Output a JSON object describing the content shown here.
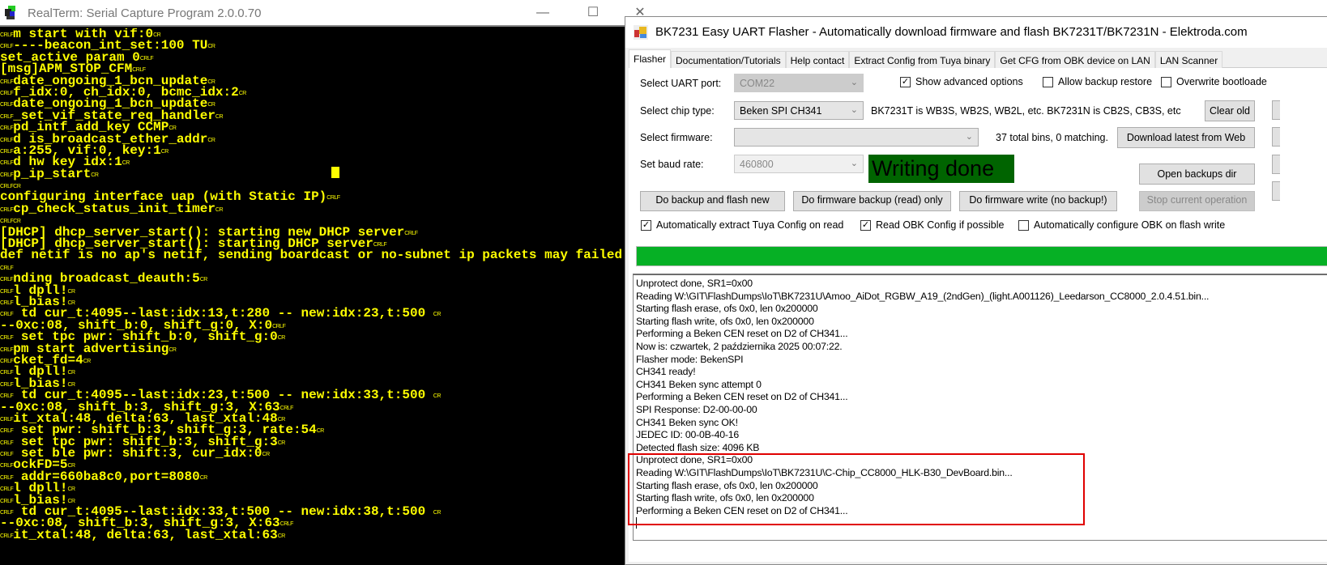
{
  "realterm": {
    "title": "RealTerm: Serial Capture Program 2.0.0.70",
    "minimize_glyph": "—",
    "maximize_glyph": "☐",
    "close_glyph": "✕",
    "lines": [
      {
        "pre": "CRLF",
        "text": "m start with vif:0",
        "post": "CR"
      },
      {
        "pre": "CRLF",
        "text": "----beacon_int_set:100 TU",
        "post": "CR"
      },
      {
        "pre": "",
        "text": "set_active param 0",
        "post": "CRLF"
      },
      {
        "pre": "",
        "text": "[msg]APM_STOP_CFM",
        "post": "CRLF"
      },
      {
        "pre": "CRLF",
        "text": "date_ongoing_1_bcn_update",
        "post": "CR"
      },
      {
        "pre": "CRLF",
        "text": "f_idx:0, ch_idx:0, bcmc_idx:2",
        "post": "CR"
      },
      {
        "pre": "CRLF",
        "text": "date_ongoing_1_bcn_update",
        "post": "CR"
      },
      {
        "pre": "CRLF",
        "text": "_set_vif_state_req_handler",
        "post": "CR"
      },
      {
        "pre": "CRLF",
        "text": "pd_intf_add_key CCMP",
        "post": "CR"
      },
      {
        "pre": "CRLF",
        "text": "d is_broadcast_ether_addr",
        "post": "CR"
      },
      {
        "pre": "CRLF",
        "text": "a:255, vif:0, key:1",
        "post": "CR"
      },
      {
        "pre": "CRLF",
        "text": "d hw key idx:1",
        "post": "CR"
      },
      {
        "pre": "CRLF",
        "text": "p_ip_start",
        "post": "CR"
      },
      {
        "pre": "CRLF",
        "text": "",
        "post": "CR"
      },
      {
        "pre": "",
        "text": "configuring interface uap (with Static IP)",
        "post": "CRLF"
      },
      {
        "pre": "CRLF",
        "text": "cp_check_status_init_timer",
        "post": "CR"
      },
      {
        "pre": "CRLF",
        "text": "",
        "post": "CR"
      },
      {
        "pre": "",
        "text": "[DHCP] dhcp_server_start(): starting new DHCP server",
        "post": "CRLF"
      },
      {
        "pre": "",
        "text": "[DHCP] dhcp_server_start(): starting DHCP server",
        "post": "CRLF"
      },
      {
        "pre": "",
        "text": "def netif is no ap's netif, sending boardcast or no-subnet ip packets may failed",
        "post": ""
      },
      {
        "pre": "CRLF",
        "text": "",
        "post": ""
      },
      {
        "pre": "CRLF",
        "text": "nding broadcast_deauth:5",
        "post": "CR"
      },
      {
        "pre": "CRLF",
        "text": "l dpll!",
        "post": "CR"
      },
      {
        "pre": "CRLF",
        "text": "l_bias!",
        "post": "CR"
      },
      {
        "pre": "CRLF",
        "text": " td cur_t:4095--last:idx:13,t:280 -- new:idx:23,t:500 ",
        "post": "CR"
      },
      {
        "pre": "",
        "text": "--0xc:08, shift_b:0, shift_g:0, X:0",
        "post": "CRLF"
      },
      {
        "pre": "CRLF",
        "text": " set tpc pwr: shift_b:0, shift_g:0",
        "post": "CR"
      },
      {
        "pre": "CRLF",
        "text": "pm start advertising",
        "post": "CR"
      },
      {
        "pre": "CRLF",
        "text": "cket_fd=4",
        "post": "CR"
      },
      {
        "pre": "CRLF",
        "text": "l dpll!",
        "post": "CR"
      },
      {
        "pre": "CRLF",
        "text": "l_bias!",
        "post": "CR"
      },
      {
        "pre": "CRLF",
        "text": " td cur_t:4095--last:idx:23,t:500 -- new:idx:33,t:500 ",
        "post": "CR"
      },
      {
        "pre": "",
        "text": "--0xc:08, shift_b:3, shift_g:3, X:63",
        "post": "CRLF"
      },
      {
        "pre": "CRLF",
        "text": "it_xtal:48, delta:63, last_xtal:48",
        "post": "CR"
      },
      {
        "pre": "CRLF",
        "text": " set pwr: shift_b:3, shift_g:3, rate:54",
        "post": "CR"
      },
      {
        "pre": "CRLF",
        "text": " set tpc pwr: shift_b:3, shift_g:3",
        "post": "CR"
      },
      {
        "pre": "CRLF",
        "text": " set ble pwr: shift:3, cur_idx:0",
        "post": "CR"
      },
      {
        "pre": "CRLF",
        "text": "ockFD=5",
        "post": "CR"
      },
      {
        "pre": "CRLF",
        "text": " addr=660ba8c0,port=8080",
        "post": "CR"
      },
      {
        "pre": "CRLF",
        "text": "l dpll!",
        "post": "CR"
      },
      {
        "pre": "CRLF",
        "text": "l_bias!",
        "post": "CR"
      },
      {
        "pre": "CRLF",
        "text": " td cur_t:4095--last:idx:33,t:500 -- new:idx:38,t:500 ",
        "post": "CR"
      },
      {
        "pre": "",
        "text": "--0xc:08, shift_b:3, shift_g:3, X:63",
        "post": "CRLF"
      },
      {
        "pre": "CRLF",
        "text": "it_xtal:48, delta:63, last_xtal:63",
        "post": "CR"
      }
    ]
  },
  "flasher": {
    "title": "BK7231 Easy UART Flasher - Automatically download firmware and flash BK7231T/BK7231N  - Elektroda.com",
    "tabs": [
      "Flasher",
      "Documentation/Tutorials",
      "Help contact",
      "Extract Config from Tuya binary",
      "Get CFG from OBK device on LAN",
      "LAN Scanner"
    ],
    "uart_label": "Select UART port:",
    "uart_value": "COM22",
    "chip_label": "Select chip type:",
    "chip_value": "Beken SPI CH341",
    "chip_hint": "BK7231T is WB3S, WB2S, WB2L, etc. BK7231N is CB2S, CB3S, etc",
    "firmware_label": "Select firmware:",
    "firmware_value": "",
    "firmware_count": "37 total bins, 0 matching.",
    "baud_label": "Set baud rate:",
    "baud_value": "460800",
    "status": "Writing done",
    "show_advanced": "Show advanced options",
    "allow_restore": "Allow backup restore",
    "overwrite_bootloader": "Overwrite bootloade",
    "clear_old": "Clear old",
    "download_latest": "Download latest from Web",
    "open_backups": "Open backups dir",
    "do_backup_flash": "Do backup and flash new",
    "do_backup_only": "Do firmware backup (read) only",
    "do_write": "Do firmware write (no backup!)",
    "stop": "Stop current operation",
    "auto_extract": "Automatically extract  Tuya Config on read",
    "read_obk": "Read OBK Config if possible",
    "auto_configure": "Automatically configure OBK on flash write",
    "progress_percent": 100,
    "chevron": "⌄",
    "check": "✓",
    "log": [
      "Unprotect done, SR1=0x00",
      "Reading W:\\GIT\\FlashDumps\\IoT\\BK7231U\\Amoo_AiDot_RGBW_A19_(2ndGen)_(light.A001126)_Leedarson_CC8000_2.0.4.51.bin...",
      "Starting flash erase, ofs 0x0, len 0x200000",
      "Starting flash write, ofs 0x0, len 0x200000",
      "Performing a Beken CEN reset on D2 of CH341...",
      "Now is: czwartek, 2 października 2025 00:07:22.",
      "Flasher mode: BekenSPI",
      "CH341 ready!",
      "CH341 Beken sync attempt 0",
      "Performing a Beken CEN reset on D2 of CH341...",
      "SPI Response: D2-00-00-00",
      "CH341 Beken sync OK!",
      "JEDEC ID: 00-0B-40-16",
      "Detected flash size: 4096 KB",
      "Unprotect done, SR1=0x00",
      "Reading W:\\GIT\\FlashDumps\\IoT\\BK7231U\\C-Chip_CC8000_HLK-B30_DevBoard.bin...",
      "Starting flash erase, ofs 0x0, len 0x200000",
      "Starting flash write, ofs 0x0, len 0x200000",
      "Performing a Beken CEN reset on D2 of CH341..."
    ]
  }
}
